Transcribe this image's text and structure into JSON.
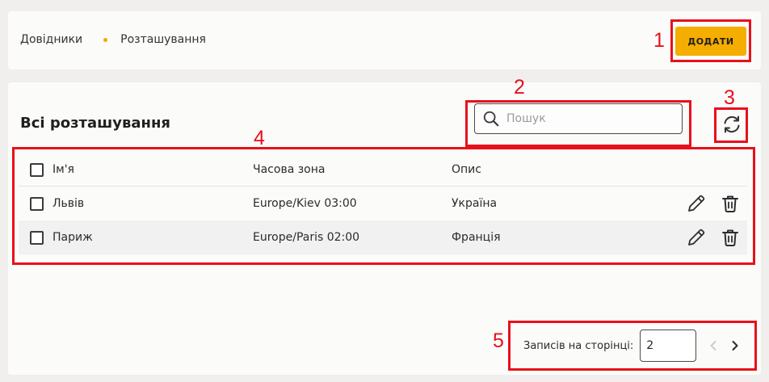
{
  "breadcrumb": {
    "parent": "Довідники",
    "current": "Розташування"
  },
  "toolbar": {
    "add_label": "ДОДАТИ"
  },
  "main": {
    "title": "Всі розташування",
    "search": {
      "placeholder": "Пошук",
      "value": ""
    }
  },
  "table": {
    "columns": [
      "Ім'я",
      "Часова зона",
      "Опис"
    ],
    "rows": [
      {
        "name": "Львів",
        "timezone": "Europe/Kiev 03:00",
        "description": "Україна"
      },
      {
        "name": "Париж",
        "timezone": "Europe/Paris 02:00",
        "description": "Франція"
      }
    ]
  },
  "pagination": {
    "label": "Записів на сторінці:",
    "per_page": "2"
  },
  "annotations": [
    "1",
    "2",
    "3",
    "4",
    "5"
  ],
  "icons": {
    "search": "search-icon",
    "refresh": "refresh-icon",
    "edit": "pencil-icon",
    "delete": "trash-icon",
    "prev": "chevron-left-icon",
    "next": "chevron-right-icon"
  },
  "colors": {
    "accent": "#f5ad00",
    "annotation": "#e8101a",
    "breadcrumb_dot": "#f5a800",
    "background": "#f0efed",
    "card": "#fbfbfa",
    "row_alt": "#f1f1f2"
  }
}
